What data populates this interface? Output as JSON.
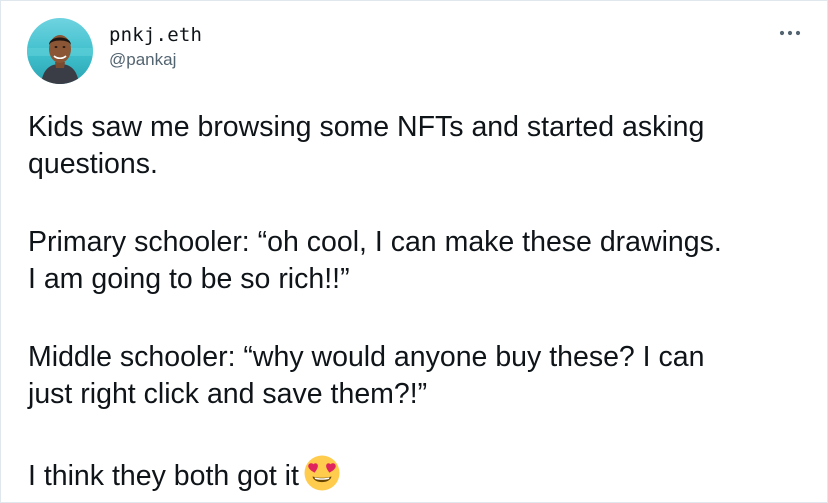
{
  "author": {
    "display_name": "pnkj.eth",
    "handle": "@pankaj"
  },
  "menu": {
    "icon": "more-horizontal-icon"
  },
  "tweet": {
    "paragraphs": [
      "Kids saw me browsing some NFTs and started asking\nquestions.",
      "Primary schooler: “oh cool, I can make these drawings.\nI am going to be so rich!!”",
      "Middle schooler: “why would anyone buy these? I can\njust right click and save them?!”",
      "I think they both got it"
    ],
    "trailing_emoji": "heart-eyes-emoji-icon"
  },
  "colors": {
    "text_primary": "#0f1419",
    "text_secondary": "#536471",
    "border": "#e1e8ed",
    "emoji_face": "#ffcc4d",
    "emoji_heart": "#e0245e"
  }
}
